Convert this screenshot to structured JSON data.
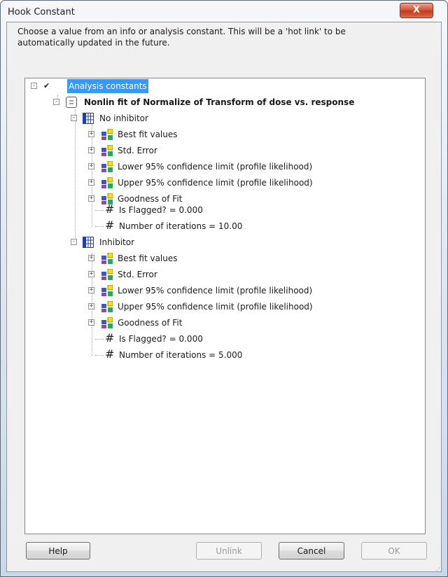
{
  "window": {
    "title": "Hook Constant",
    "close_glyph": "X"
  },
  "instruction": "Choose a value from an info or analysis constant. This will be a 'hot link' to be automatically updated in the future.",
  "tree": {
    "root": {
      "label": "Analysis constants"
    },
    "analysis": {
      "label": "Nonlin fit of Normalize of Transform of dose vs. response"
    },
    "groups": [
      {
        "label": "No inhibitor",
        "results": [
          "Best fit values",
          "Std. Error",
          "Lower 95% confidence limit (profile likelihood)",
          "Upper 95% confidence limit (profile likelihood)",
          "Goodness of Fit"
        ],
        "values": [
          "Is Flagged? = 0.000",
          "Number of iterations = 10.00"
        ]
      },
      {
        "label": "Inhibitor",
        "results": [
          "Best fit values",
          "Std. Error",
          "Lower 95% confidence limit (profile likelihood)",
          "Upper 95% confidence limit (profile likelihood)",
          "Goodness of Fit"
        ],
        "values": [
          "Is Flagged? = 0.000",
          "Number of iterations = 5.000"
        ]
      }
    ]
  },
  "buttons": {
    "help": "Help",
    "unlink": "Unlink",
    "cancel": "Cancel",
    "ok": "OK"
  },
  "colors": {
    "selection": "#3399ff",
    "table_icon": "#1f3fb0"
  }
}
